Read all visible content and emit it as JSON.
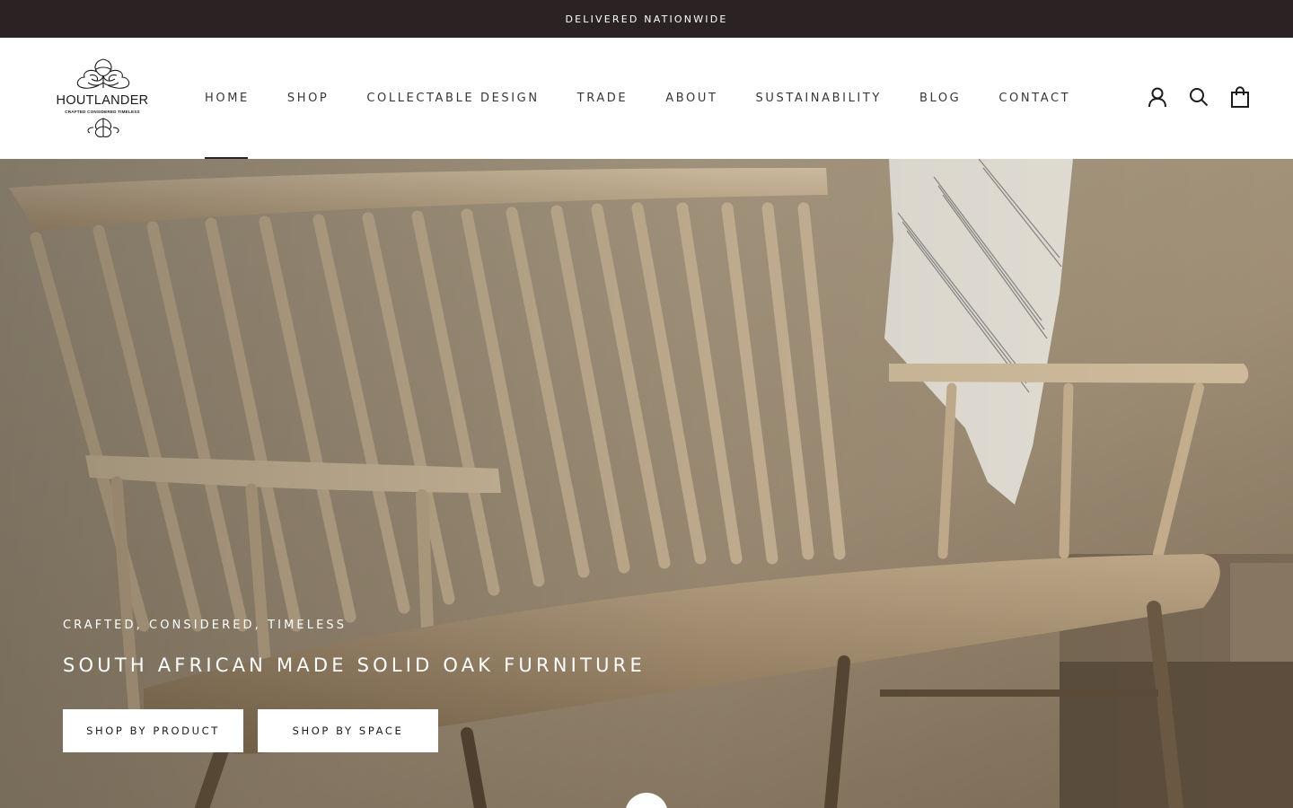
{
  "announcement": {
    "text": "DELIVERED NATIONWIDE"
  },
  "logo": {
    "title": "HOUTLANDER",
    "tagline": "CRAFTED CONSIDERED TIMELESS"
  },
  "nav": {
    "items": [
      {
        "label": "HOME",
        "active": true
      },
      {
        "label": "SHOP"
      },
      {
        "label": "COLLECTABLE DESIGN"
      },
      {
        "label": "TRADE"
      },
      {
        "label": "ABOUT"
      },
      {
        "label": "SUSTAINABILITY"
      },
      {
        "label": "BLOG"
      },
      {
        "label": "CONTACT"
      }
    ]
  },
  "header_icons": [
    "account-icon",
    "search-icon",
    "cart-icon"
  ],
  "hero": {
    "subtitle": "CRAFTED, CONSIDERED, TIMELESS",
    "title": "SOUTH AFRICAN MADE SOLID OAK FURNITURE",
    "buttons": {
      "product": "SHOP BY PRODUCT",
      "space": "SHOP BY SPACE"
    }
  },
  "colors": {
    "announcement_bg": "#2a2223",
    "text": "#1c1b1b",
    "nav_text": "#3b3636"
  }
}
